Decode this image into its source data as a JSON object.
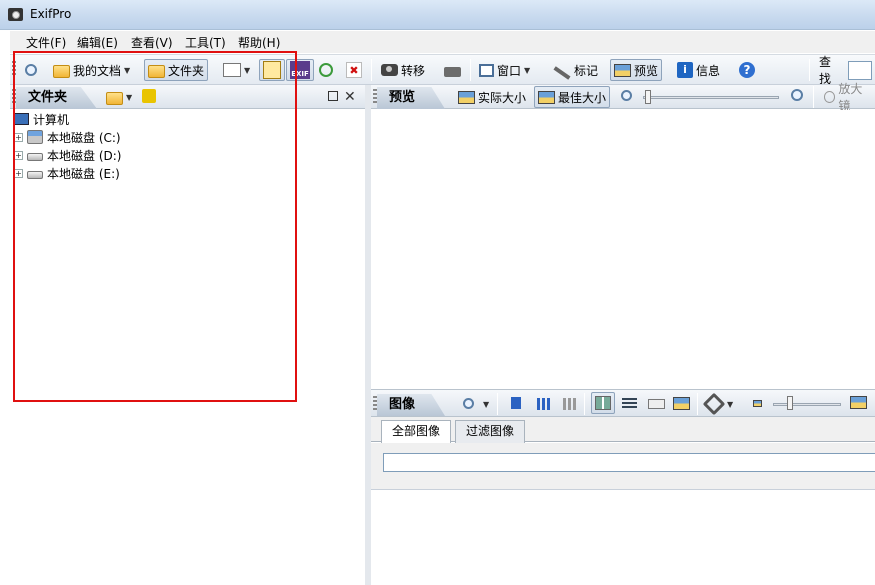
{
  "window": {
    "title": "ExifPro"
  },
  "menu": [
    "文件(F)",
    "编辑(E)",
    "查看(V)",
    "工具(T)",
    "帮助(H)"
  ],
  "toolbar": {
    "my_documents": "我的文档",
    "folder": "文件夹",
    "transfer": "转移",
    "window": "窗口",
    "mark": "标记",
    "preview": "预览",
    "info": "信息",
    "find": "查找",
    "help_glyph": "?",
    "info_glyph": "i",
    "exif_glyph": "EXIF",
    "delete_glyph": "✖"
  },
  "folder_pane": {
    "tab": "文件夹",
    "close_glyph": "✕",
    "tree": [
      {
        "label": "计算机",
        "icon": "computer-icon"
      },
      {
        "label": "本地磁盘 (C:)",
        "icon": "system-drive-icon"
      },
      {
        "label": "本地磁盘 (D:)",
        "icon": "drive-icon"
      },
      {
        "label": "本地磁盘 (E:)",
        "icon": "drive-icon"
      }
    ],
    "expander_glyph": "+"
  },
  "preview_pane": {
    "tab": "预览",
    "actual_size": "实际大小",
    "best_fit": "最佳大小",
    "zoom_in": "放大镜"
  },
  "image_pane": {
    "tab": "图像",
    "tabs": [
      "全部图像",
      "过滤图像"
    ]
  },
  "colors": {
    "highlight": "#e01010",
    "accent": "#1f66c2"
  }
}
